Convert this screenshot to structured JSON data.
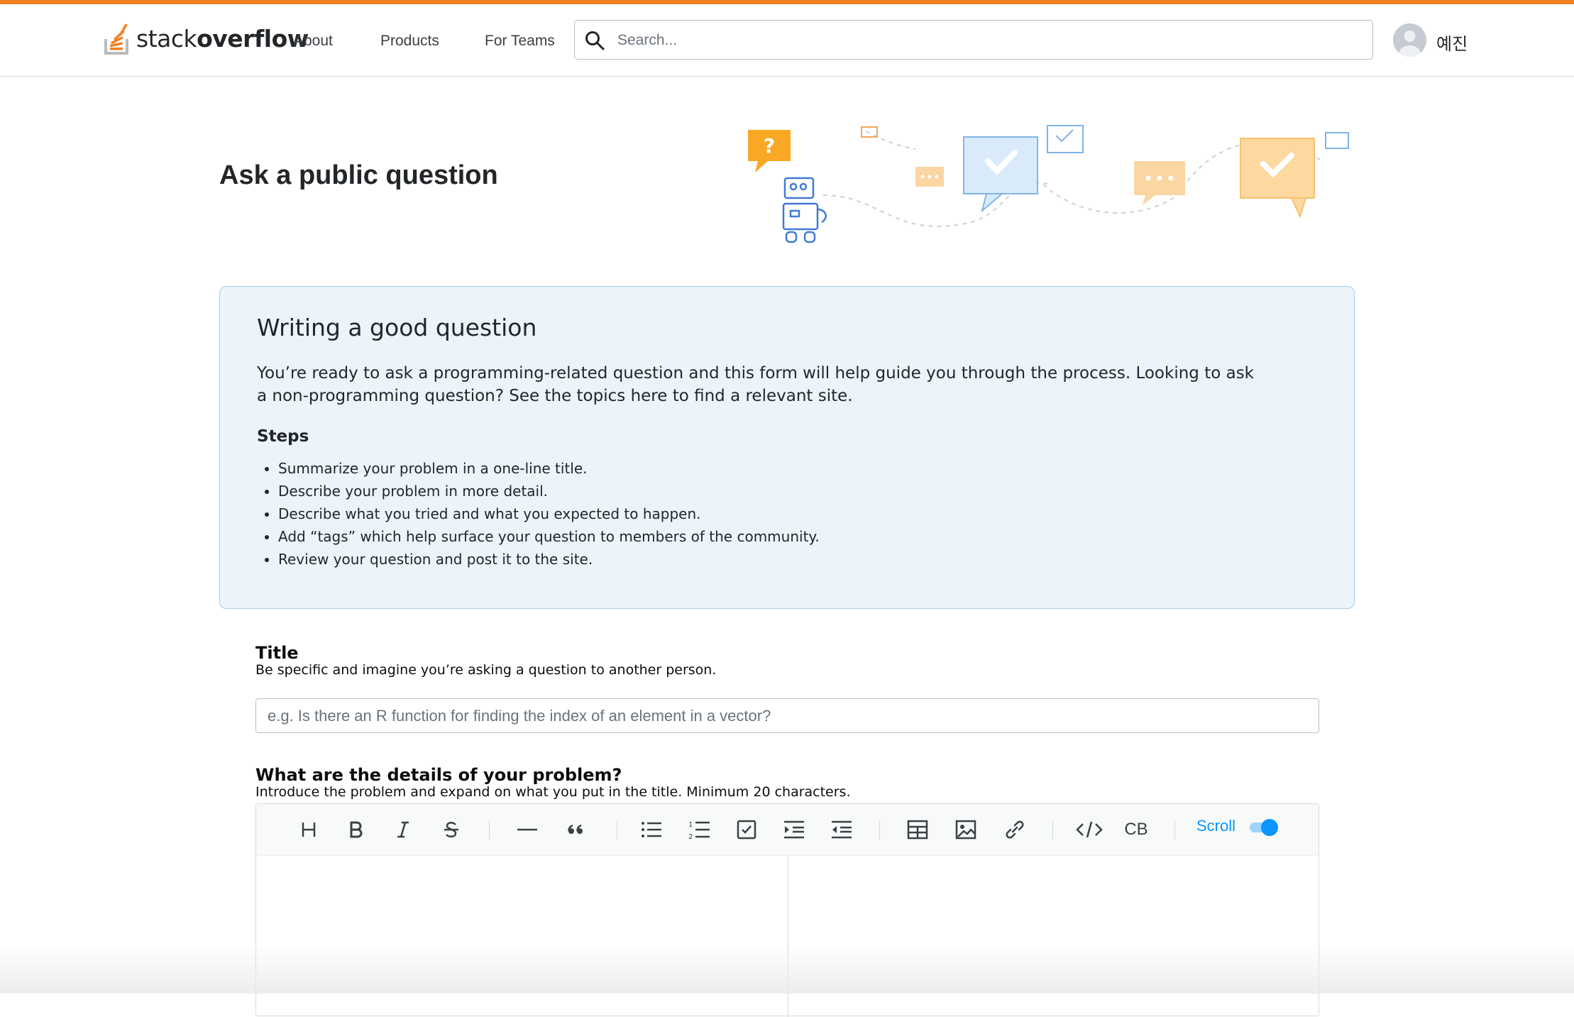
{
  "header": {
    "logo_light": "stack",
    "logo_bold": "overflow",
    "nav": [
      "About",
      "Products",
      "For Teams"
    ],
    "search_placeholder": "Search...",
    "username": "예진"
  },
  "page": {
    "title": "Ask a public question"
  },
  "notice": {
    "heading": "Writing a good question",
    "body": "You’re ready to ask a programming-related question and this form will help guide you through the process. Looking to ask a non-programming question? See the topics here to find a relevant site.",
    "steps_heading": "Steps",
    "steps": [
      "Summarize your problem in a one-line title.",
      "Describe your problem in more detail.",
      "Describe what you tried and what you expected to happen.",
      "Add “tags” which help surface your question to members of the community.",
      "Review your question and post it to the site."
    ]
  },
  "title_field": {
    "label": "Title",
    "help": "Be specific and imagine you’re asking a question to another person.",
    "placeholder": "e.g. Is there an R function for finding the index of an element in a vector?",
    "value": ""
  },
  "details_field": {
    "label": "What are the details of your problem?",
    "help": "Introduce the problem and expand on what you put in the title. Minimum 20 characters."
  },
  "editor": {
    "toolbar": [
      "heading-icon",
      "bold-icon",
      "italic-icon",
      "strikethrough-icon",
      "horizontal-rule-icon",
      "blockquote-icon",
      "bullet-list-icon",
      "numbered-list-icon",
      "task-list-icon",
      "indent-icon",
      "outdent-icon",
      "table-icon",
      "image-icon",
      "link-icon",
      "code-icon",
      "code-block-icon"
    ],
    "code_block_label": "CB",
    "scroll_label": "Scroll",
    "scroll_sync_on": true
  },
  "colors": {
    "brand_orange": "#f48024",
    "notice_bg": "#ebf4fb",
    "notice_border": "#a6ceed",
    "toggle_blue": "#0a95ff"
  }
}
